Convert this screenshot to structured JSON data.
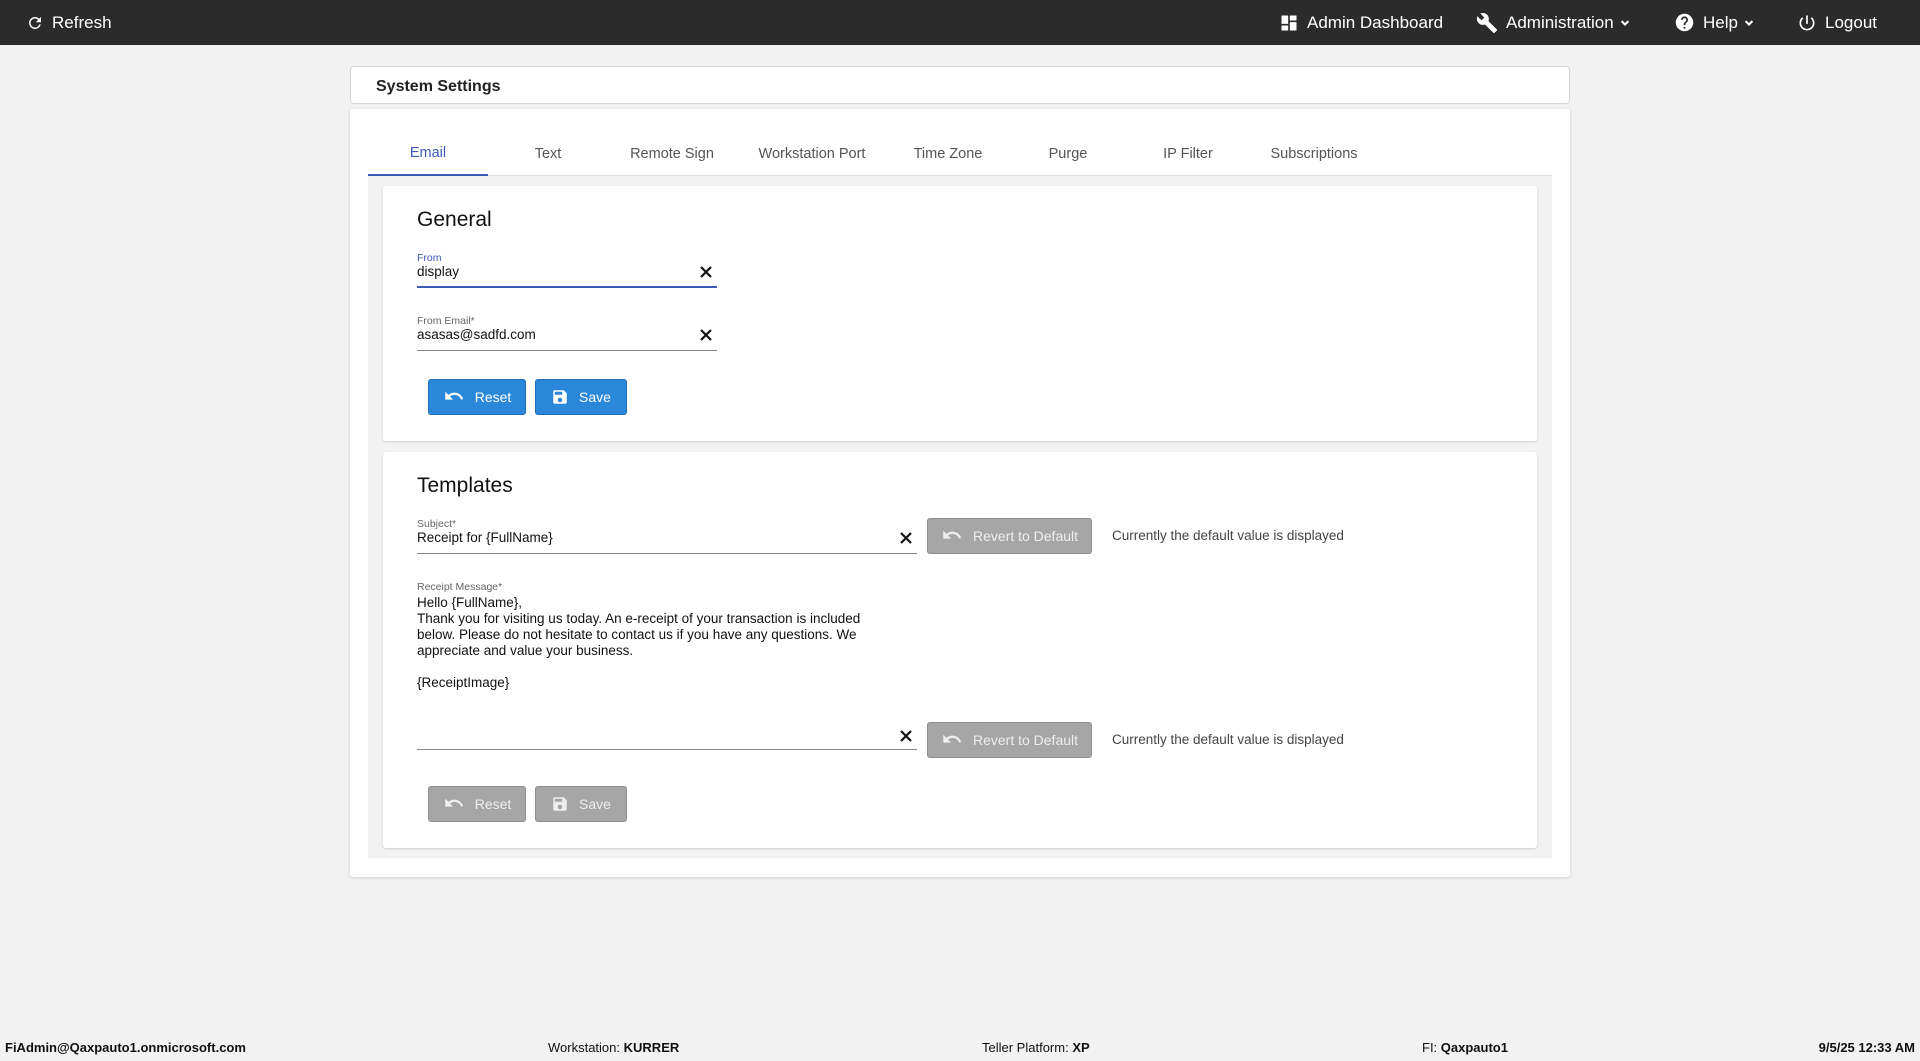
{
  "topbar": {
    "refresh_label": "Refresh",
    "admin_dashboard_label": "Admin Dashboard",
    "administration_label": "Administration",
    "help_label": "Help",
    "logout_label": "Logout"
  },
  "page_title": "System Settings",
  "tabs": [
    {
      "label": "Email",
      "active": true
    },
    {
      "label": "Text"
    },
    {
      "label": "Remote Sign"
    },
    {
      "label": "Workstation Port"
    },
    {
      "label": "Time Zone"
    },
    {
      "label": "Purge"
    },
    {
      "label": "IP Filter"
    },
    {
      "label": "Subscriptions"
    }
  ],
  "general": {
    "title": "General",
    "from": {
      "label": "From",
      "value": "display"
    },
    "from_email": {
      "label": "From Email*",
      "value": "asasas@sadfd.com"
    },
    "reset_label": "Reset",
    "save_label": "Save"
  },
  "templates": {
    "title": "Templates",
    "subject": {
      "label": "Subject*",
      "value": "Receipt for {FullName}"
    },
    "receipt_message": {
      "label": "Receipt Message*",
      "value": "Hello {FullName},\nThank you for visiting us today. An e-receipt of your transaction is included below. Please do not hesitate to contact us if you have any questions. We appreciate and value your business.\n\n{ReceiptImage}"
    },
    "revert_label": "Revert to Default",
    "default_note": "Currently the default value is displayed",
    "reset_label": "Reset",
    "save_label": "Save"
  },
  "footer": {
    "user": "FiAdmin@Qaxpauto1.onmicrosoft.com",
    "workstation_label": "Workstation:",
    "workstation_value": "KURRER",
    "platform_label": "Teller Platform:",
    "platform_value": "XP",
    "fi_label": "FI:",
    "fi_value": "Qaxpauto1",
    "datetime": "9/5/25 12:33 AM"
  },
  "colors": {
    "topbar": "#2b2b2b",
    "primary_button": "#2b87d9",
    "disabled_button": "#a6a6a6",
    "active_tab": "#3b5bb5"
  }
}
